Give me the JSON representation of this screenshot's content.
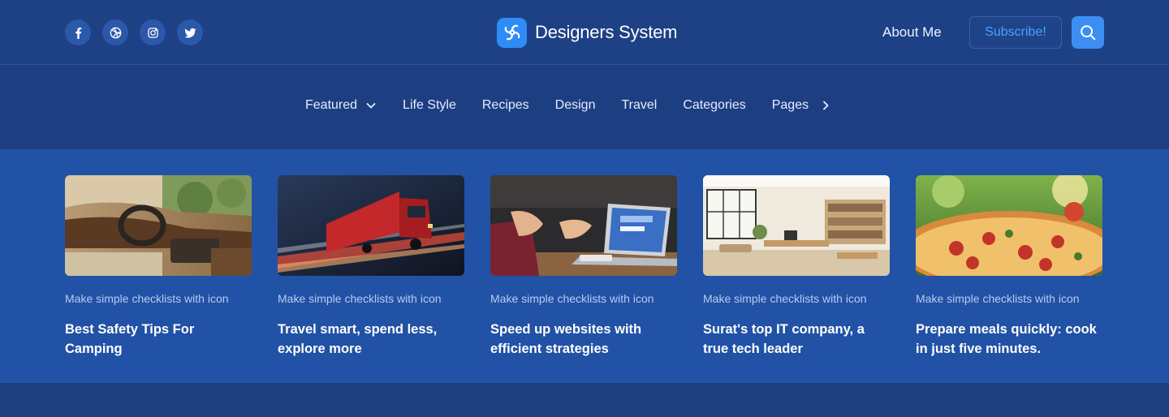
{
  "header": {
    "socials": [
      {
        "icon": "facebook-icon",
        "label": "Facebook"
      },
      {
        "icon": "dribbble-icon",
        "label": "Dribbble"
      },
      {
        "icon": "instagram-icon",
        "label": "Instagram"
      },
      {
        "icon": "twitter-icon",
        "label": "Twitter"
      }
    ],
    "brand_name": "Designers System",
    "about_label": "About Me",
    "subscribe_label": "Subscribe!",
    "search_icon": "search-icon"
  },
  "nav": {
    "items": [
      {
        "label": "Featured",
        "icon": "chevron-down-icon"
      },
      {
        "label": "Life Style"
      },
      {
        "label": "Recipes"
      },
      {
        "label": "Design"
      },
      {
        "label": "Travel"
      },
      {
        "label": "Categories"
      },
      {
        "label": "Pages",
        "icon": "chevron-right-icon"
      }
    ]
  },
  "posts": [
    {
      "tag": "Make simple checklists with icon",
      "title": "Best Safety Tips For Camping",
      "image": "car-interior"
    },
    {
      "tag": "Make simple checklists with icon",
      "title": "Travel smart, spend less, explore more",
      "image": "red-truck"
    },
    {
      "tag": "Make simple checklists with icon",
      "title": "Speed up websites with efficient strategies",
      "image": "laptop-hands"
    },
    {
      "tag": "Make simple checklists with icon",
      "title": "Surat's top IT company, a true tech leader",
      "image": "office-space"
    },
    {
      "tag": "Make simple checklists with icon",
      "title": "Prepare meals quickly: cook in just five minutes.",
      "image": "pizza"
    }
  ],
  "colors": {
    "background": "#1d3f80",
    "posts_band": "#2152a6",
    "accent": "#3d8ef3",
    "subscribe_text": "#4aa3ff"
  }
}
